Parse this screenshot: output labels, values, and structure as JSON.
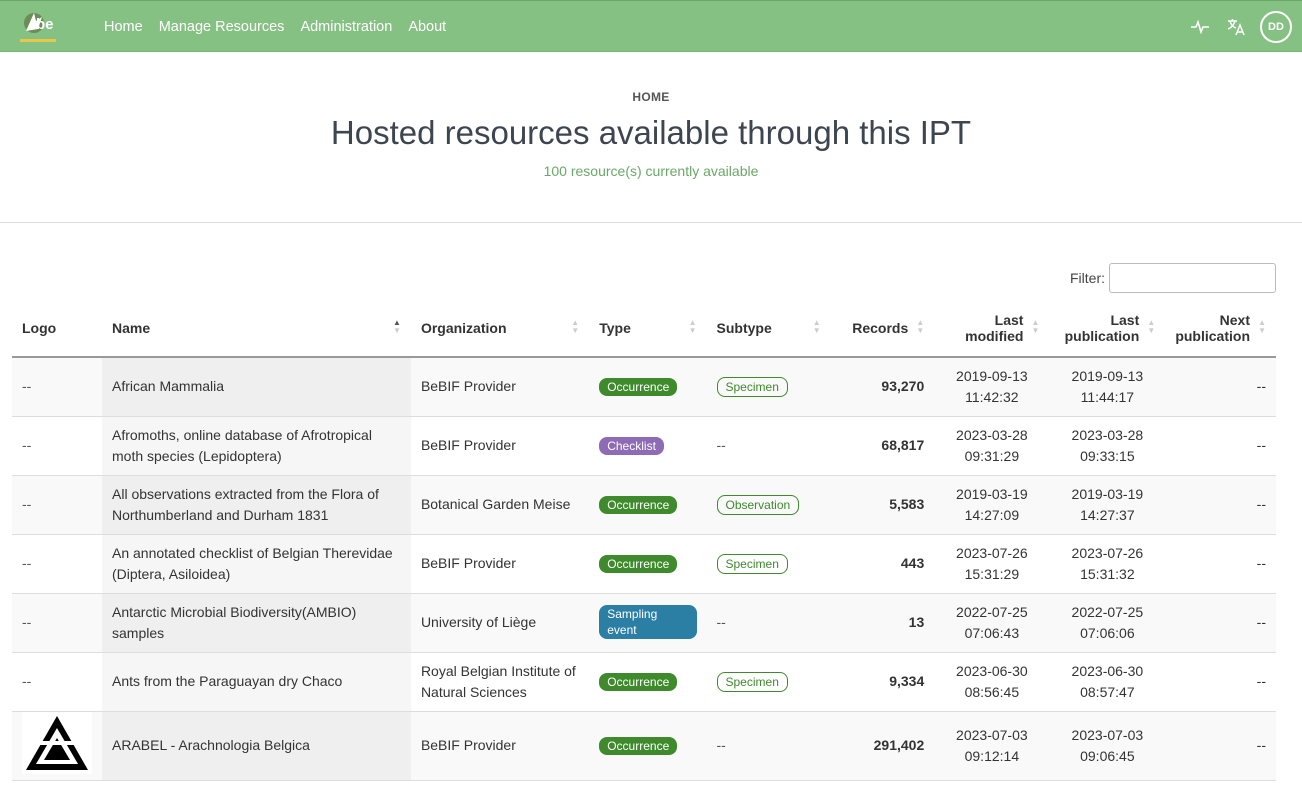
{
  "nav": {
    "logo_text": "be",
    "items": [
      "Home",
      "Manage Resources",
      "Administration",
      "About"
    ],
    "user_initials": "DD",
    "icons": [
      "pulse-icon",
      "translate-icon"
    ]
  },
  "hero": {
    "breadcrumb": "HOME",
    "title": "Hosted resources available through this IPT",
    "subtitle": "100 resource(s) currently available"
  },
  "filter": {
    "label": "Filter:",
    "value": ""
  },
  "table": {
    "headers": [
      "Logo",
      "Name",
      "Organization",
      "Type",
      "Subtype",
      "Records",
      "Last modified",
      "Last publication",
      "Next publication"
    ],
    "rows": [
      {
        "logo": "--",
        "name": "African Mammalia",
        "org": "BeBIF Provider",
        "type": "Occurrence",
        "type_class": "b-occ",
        "subtype": "Specimen",
        "records": "93,270",
        "mod_date": "2019-09-13",
        "mod_time": "11:42:32",
        "pub_date": "2019-09-13",
        "pub_time": "11:44:17",
        "next": "--"
      },
      {
        "logo": "--",
        "name": "Afromoths, online database of Afrotropical moth species (Lepidoptera)",
        "org": "BeBIF Provider",
        "type": "Checklist",
        "type_class": "b-chk",
        "subtype": "--",
        "records": "68,817",
        "mod_date": "2023-03-28",
        "mod_time": "09:31:29",
        "pub_date": "2023-03-28",
        "pub_time": "09:33:15",
        "next": "--"
      },
      {
        "logo": "--",
        "name": "All observations extracted from the Flora of Northumberland and Durham 1831",
        "org": "Botanical Garden Meise",
        "type": "Occurrence",
        "type_class": "b-occ",
        "subtype": "Observation",
        "records": "5,583",
        "mod_date": "2019-03-19",
        "mod_time": "14:27:09",
        "pub_date": "2019-03-19",
        "pub_time": "14:27:37",
        "next": "--"
      },
      {
        "logo": "--",
        "name": "An annotated checklist of Belgian Therevidae (Diptera, Asiloidea)",
        "org": "BeBIF Provider",
        "type": "Occurrence",
        "type_class": "b-occ",
        "subtype": "Specimen",
        "records": "443",
        "mod_date": "2023-07-26",
        "mod_time": "15:31:29",
        "pub_date": "2023-07-26",
        "pub_time": "15:31:32",
        "next": "--"
      },
      {
        "logo": "--",
        "name": "Antarctic Microbial Biodiversity(AMBIO) samples",
        "org": "University of Liège",
        "type": "Sampling event",
        "type_class": "b-sam",
        "subtype": "--",
        "records": "13",
        "mod_date": "2022-07-25",
        "mod_time": "07:06:43",
        "pub_date": "2022-07-25",
        "pub_time": "07:06:06",
        "next": "--"
      },
      {
        "logo": "--",
        "name": "Ants from the Paraguayan dry Chaco",
        "org": "Royal Belgian Institute of Natural Sciences",
        "type": "Occurrence",
        "type_class": "b-occ",
        "subtype": "Specimen",
        "records": "9,334",
        "mod_date": "2023-06-30",
        "mod_time": "08:56:45",
        "pub_date": "2023-06-30",
        "pub_time": "08:57:47",
        "next": "--"
      },
      {
        "logo": "",
        "name": "ARABEL - Arachnologia Belgica",
        "org": "BeBIF Provider",
        "type": "Occurrence",
        "type_class": "b-occ",
        "subtype": "--",
        "records": "291,402",
        "mod_date": "2023-07-03",
        "mod_time": "09:12:14",
        "pub_date": "2023-07-03",
        "pub_time": "09:06:45",
        "next": "--"
      }
    ]
  }
}
